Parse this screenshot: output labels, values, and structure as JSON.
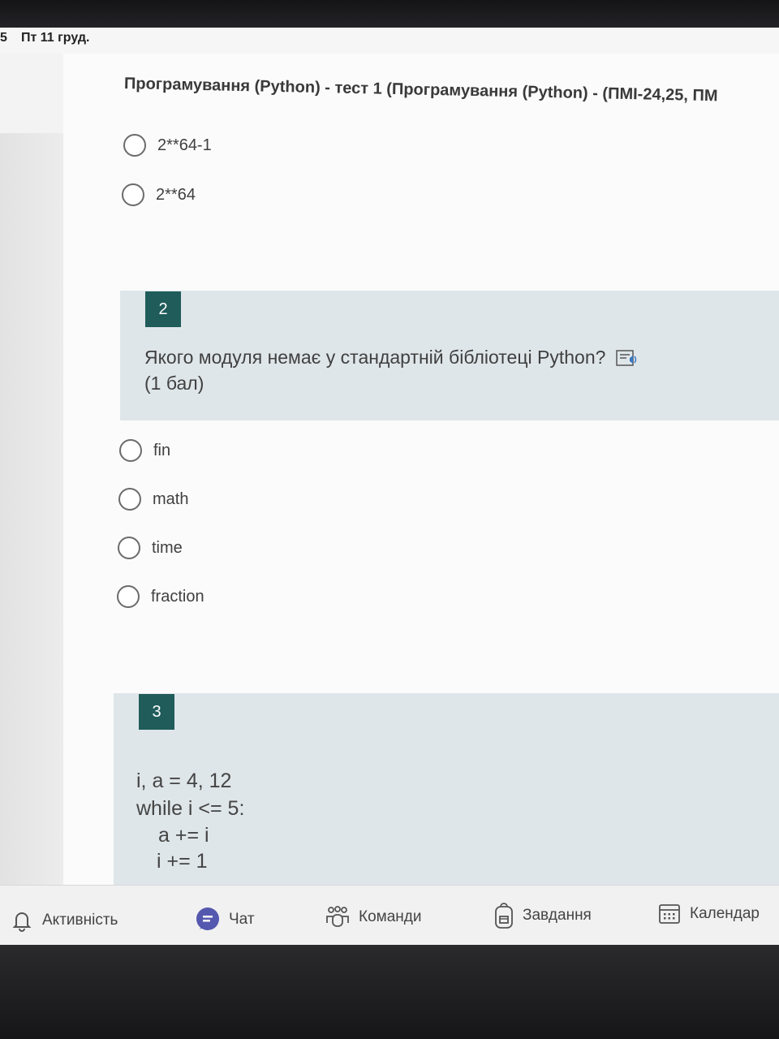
{
  "status_bar": {
    "time": "5",
    "date": "Пт 11 груд."
  },
  "test_title": "Програмування (Python) - тест 1 (Програмування (Python) - (ПМІ-24,25, ПМ",
  "q1_options": [
    "2**64-1",
    "2**64"
  ],
  "question2": {
    "number": "2",
    "text": "Якого модуля немає у стандартній бібліотеці Python?",
    "points": "(1 бал)",
    "options": [
      "fin",
      "math",
      "time",
      "fraction"
    ]
  },
  "question3": {
    "number": "3",
    "code": [
      "i, a = 4, 12",
      "while i <= 5:",
      "a += i",
      "i += 1"
    ]
  },
  "bottom_nav": [
    {
      "label": "Активність",
      "icon": "bell-icon"
    },
    {
      "label": "Чат",
      "icon": "chat-icon"
    },
    {
      "label": "Команди",
      "icon": "teams-icon"
    },
    {
      "label": "Завдання",
      "icon": "backpack-icon"
    },
    {
      "label": "Календар",
      "icon": "calendar-icon"
    }
  ],
  "colors": {
    "question_number_bg": "#1f5c5a",
    "question_block_bg": "#dfe6ea",
    "chat_icon": "#5558af"
  }
}
